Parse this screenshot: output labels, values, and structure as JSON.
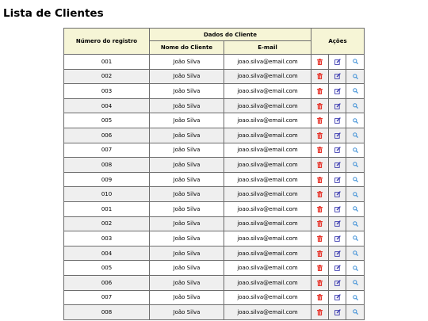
{
  "page": {
    "title": "Lista de Clientes"
  },
  "table": {
    "headers": {
      "registro": "Número do registro",
      "dados": "Dados do Cliente",
      "nome": "Nome do Cliente",
      "email": "E-mail",
      "acoes": "Ações"
    },
    "rows": [
      {
        "registro": "001",
        "nome": "João Silva",
        "email": "joao.silva@email.com"
      },
      {
        "registro": "002",
        "nome": "João Silva",
        "email": "joao.silva@email.com"
      },
      {
        "registro": "003",
        "nome": "João Silva",
        "email": "joao.silva@email.com"
      },
      {
        "registro": "004",
        "nome": "João Silva",
        "email": "joao.silva@email.com"
      },
      {
        "registro": "005",
        "nome": "João Silva",
        "email": "joao.silva@email.com"
      },
      {
        "registro": "006",
        "nome": "João Silva",
        "email": "joao.silva@email.com"
      },
      {
        "registro": "007",
        "nome": "João Silva",
        "email": "joao.silva@email.com"
      },
      {
        "registro": "008",
        "nome": "João Silva",
        "email": "joao.silva@email.com"
      },
      {
        "registro": "009",
        "nome": "João Silva",
        "email": "joao.silva@email.com"
      },
      {
        "registro": "010",
        "nome": "João Silva",
        "email": "joao.silva@email.com"
      },
      {
        "registro": "001",
        "nome": "João Silva",
        "email": "joao.silva@email.com"
      },
      {
        "registro": "002",
        "nome": "João Silva",
        "email": "joao.silva@email.com"
      },
      {
        "registro": "003",
        "nome": "João Silva",
        "email": "joao.silva@email.com"
      },
      {
        "registro": "004",
        "nome": "João Silva",
        "email": "joao.silva@email.com"
      },
      {
        "registro": "005",
        "nome": "João Silva",
        "email": "joao.silva@email.com"
      },
      {
        "registro": "006",
        "nome": "João Silva",
        "email": "joao.silva@email.com"
      },
      {
        "registro": "007",
        "nome": "João Silva",
        "email": "joao.silva@email.com"
      },
      {
        "registro": "008",
        "nome": "João Silva",
        "email": "joao.silva@email.com"
      }
    ]
  },
  "actions": [
    {
      "name": "delete",
      "icon": "trash-icon",
      "color": "#e5332a"
    },
    {
      "name": "edit",
      "icon": "edit-icon",
      "color": "#3b3bb0"
    },
    {
      "name": "view",
      "icon": "search-icon",
      "color": "#3d8fd6"
    }
  ],
  "colors": {
    "header_bg": "#f6f5d6",
    "row_alt_bg": "#efefef",
    "border": "#6d6d6d"
  }
}
